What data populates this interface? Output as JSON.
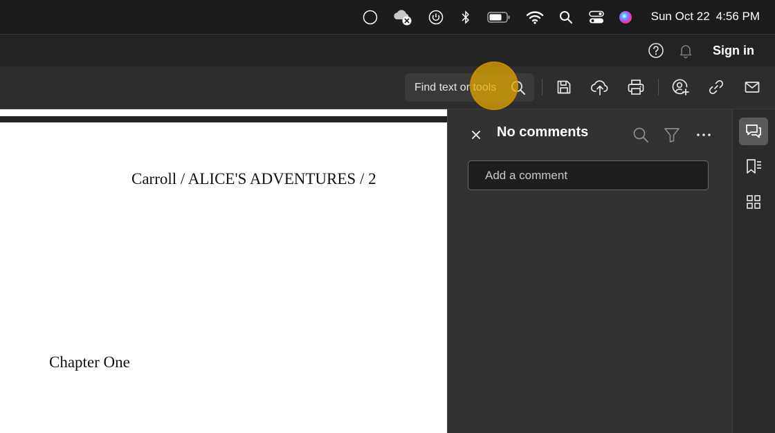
{
  "menubar": {
    "date": "Sun Oct 22",
    "time": "4:56 PM"
  },
  "titlebar": {
    "signin_label": "Sign in"
  },
  "toolbar": {
    "search_placeholder": "Find text or tools"
  },
  "document": {
    "header_text": "Carroll / ALICE'S ADVENTURES / 2",
    "chapter_text": "Chapter One"
  },
  "comments": {
    "title": "No comments",
    "input_placeholder": "Add a comment"
  },
  "colors": {
    "cursor_highlight": "#e6aa00",
    "panel_bg": "#323232",
    "toolbar_bg": "#2d2d2d"
  }
}
